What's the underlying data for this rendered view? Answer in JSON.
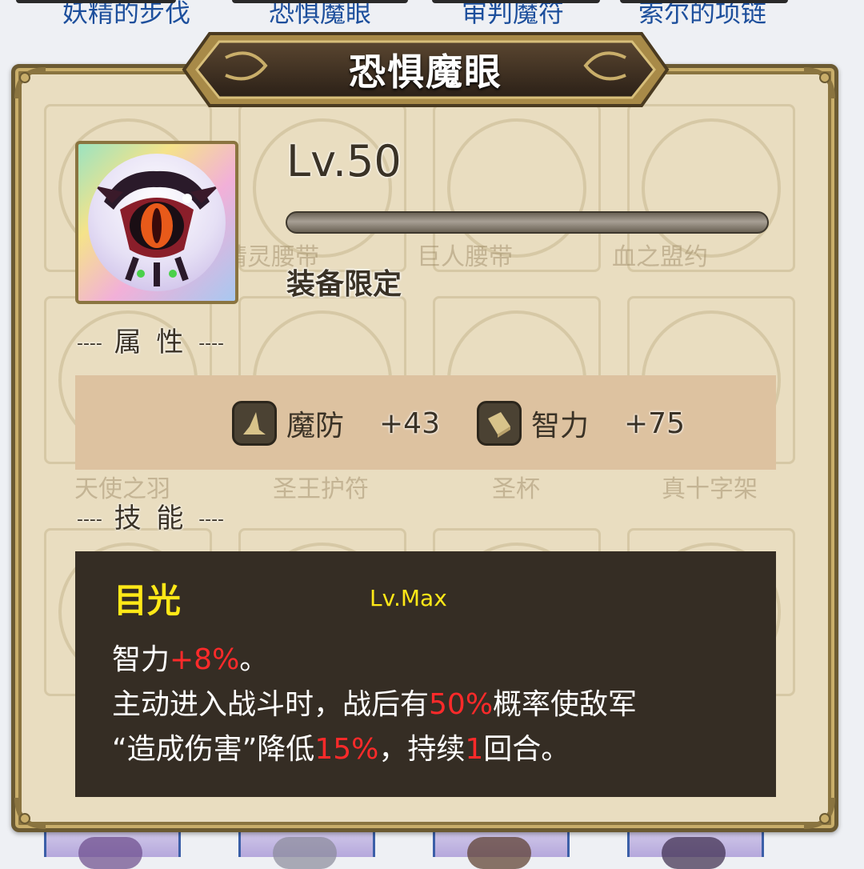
{
  "top_tabs": [
    "妖精的步伐",
    "恐惧魔眼",
    "审判魔符",
    "索尔的项链"
  ],
  "title": "恐惧魔眼",
  "item": {
    "icon": "dread-eye-icon"
  },
  "level_text": "Lv.50",
  "xp_progress": 1.0,
  "equip_restriction": "装备限定",
  "sections": {
    "attributes": "属 性",
    "skills": "技 能"
  },
  "attributes": [
    {
      "icon": "wizard-hat-icon",
      "name": "魔防",
      "value": "+43"
    },
    {
      "icon": "book-icon",
      "name": "智力",
      "value": "+75"
    }
  ],
  "skill": {
    "name": "目光",
    "level": "Lv.Max",
    "line1": {
      "a": "智力",
      "b": "+8%",
      "c": "。"
    },
    "line2": {
      "a": "主动进入战斗时，战后有",
      "b": "50%",
      "c": "概率使敌军"
    },
    "line3": {
      "a": "“造成伤害”降低",
      "b": "15%",
      "c": "，持续",
      "d": "1",
      "e": "回合。"
    }
  },
  "background_labels": [
    "精灵腰带",
    "巨人腰带",
    "血之盟约",
    "天使之羽",
    "圣王护符",
    "圣杯",
    "真十字架"
  ],
  "colors": {
    "highlight": "#ff2a2a",
    "skill_title": "#ffe817",
    "panel": "#e9ddc0",
    "tab_text": "#1d4f9c"
  }
}
